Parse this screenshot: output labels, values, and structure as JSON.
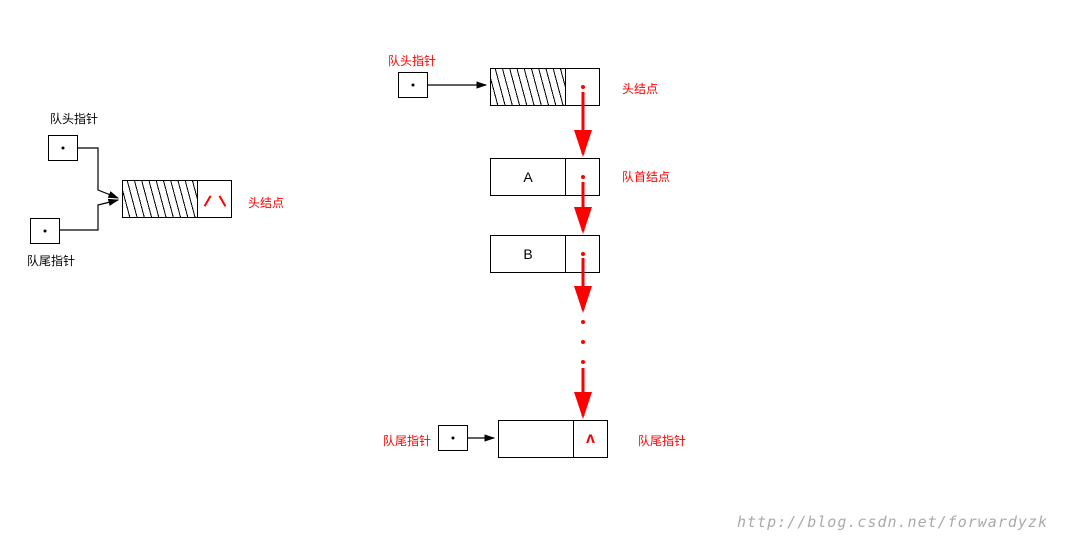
{
  "left": {
    "head_ptr_label": "队头指针",
    "tail_ptr_label": "队尾指针",
    "head_node_label": "头结点"
  },
  "right": {
    "head_ptr_label": "队头指针",
    "tail_ptr_label": "队尾指针",
    "head_node_label": "头结点",
    "first_node_label": "队首结点",
    "tail_node_label": "队尾指针",
    "node_a": "A",
    "node_b": "B"
  },
  "watermark": "http://blog.csdn.net/forwardyzk"
}
